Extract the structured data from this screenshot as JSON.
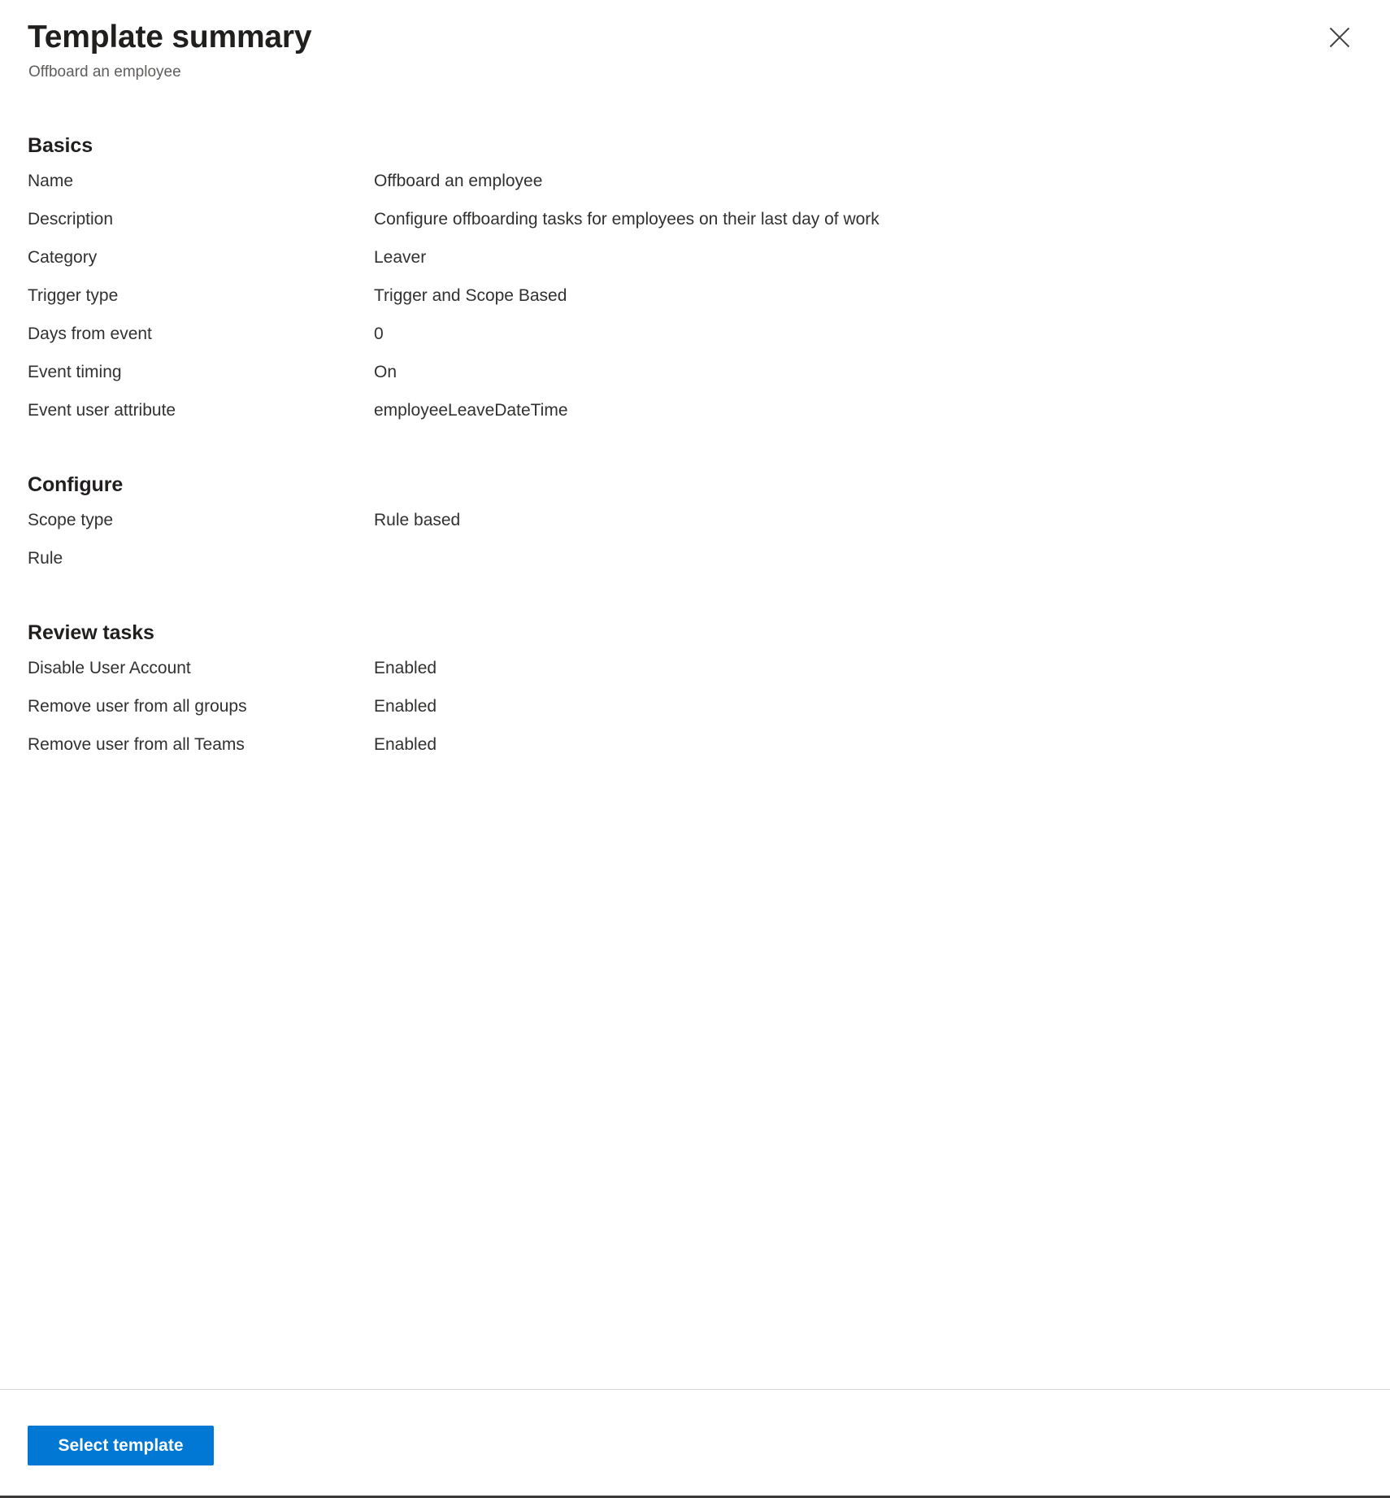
{
  "header": {
    "title": "Template summary",
    "subtitle": "Offboard an employee",
    "close_icon": "close-icon"
  },
  "sections": [
    {
      "title": "Basics",
      "rows": [
        {
          "label": "Name",
          "value": "Offboard an employee"
        },
        {
          "label": "Description",
          "value": "Configure offboarding tasks for employees on their last day of work"
        },
        {
          "label": "Category",
          "value": "Leaver"
        },
        {
          "label": "Trigger type",
          "value": "Trigger and Scope Based"
        },
        {
          "label": "Days from event",
          "value": "0"
        },
        {
          "label": "Event timing",
          "value": "On"
        },
        {
          "label": "Event user attribute",
          "value": "employeeLeaveDateTime"
        }
      ]
    },
    {
      "title": "Configure",
      "rows": [
        {
          "label": "Scope type",
          "value": "Rule based"
        },
        {
          "label": "Rule",
          "value": ""
        }
      ]
    },
    {
      "title": "Review tasks",
      "rows": [
        {
          "label": "Disable User Account",
          "value": "Enabled"
        },
        {
          "label": "Remove user from all groups",
          "value": "Enabled"
        },
        {
          "label": "Remove user from all Teams",
          "value": "Enabled"
        }
      ]
    }
  ],
  "footer": {
    "select_template_label": "Select template"
  },
  "colors": {
    "primary": "#0078d4",
    "text": "#323130",
    "subtle_text": "#605e5c",
    "divider": "#d6d6d6"
  }
}
